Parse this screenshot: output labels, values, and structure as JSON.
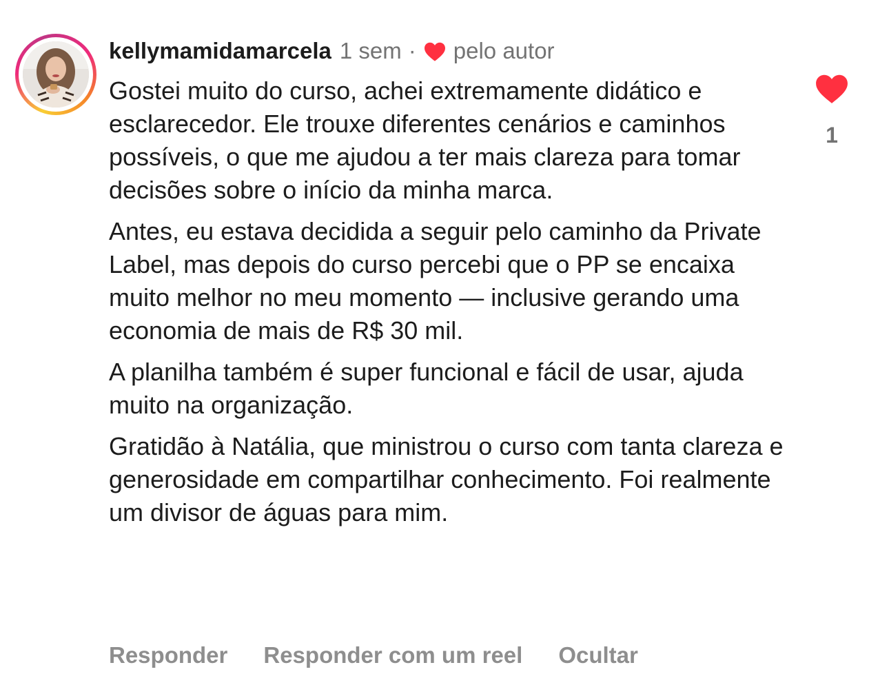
{
  "comment": {
    "username": "kellymamidamarcela",
    "time": "1 sem",
    "separator": "·",
    "liked_by_author": "pelo autor",
    "paragraphs": [
      "Gostei muito do curso, achei extremamente didático e esclarecedor. Ele trouxe diferentes cenários e caminhos possíveis, o que me ajudou a ter mais clareza para tomar decisões sobre o início da minha marca.",
      "Antes, eu estava decidida a seguir pelo caminho da Private Label, mas depois do curso percebi que o PP se encaixa muito melhor no meu momento — inclusive gerando uma economia de mais de R$ 30 mil.",
      "A planilha também é super funcional e fácil de usar, ajuda muito na organização.",
      "Gratidão à Natália, que ministrou o curso com tanta clareza e generosidade em compartilhar conhecimento. Foi realmente um divisor de águas para mim."
    ],
    "like_count": "1"
  },
  "actions": {
    "reply": "Responder",
    "reply_with_reel": "Responder com um reel",
    "hide": "Ocultar"
  },
  "icons": {
    "author_heart": "heart-icon",
    "like_heart": "heart-filled-icon"
  },
  "colors": {
    "heart": "#ff3040",
    "meta_text": "#737373",
    "action_text": "#8e8e8e"
  }
}
